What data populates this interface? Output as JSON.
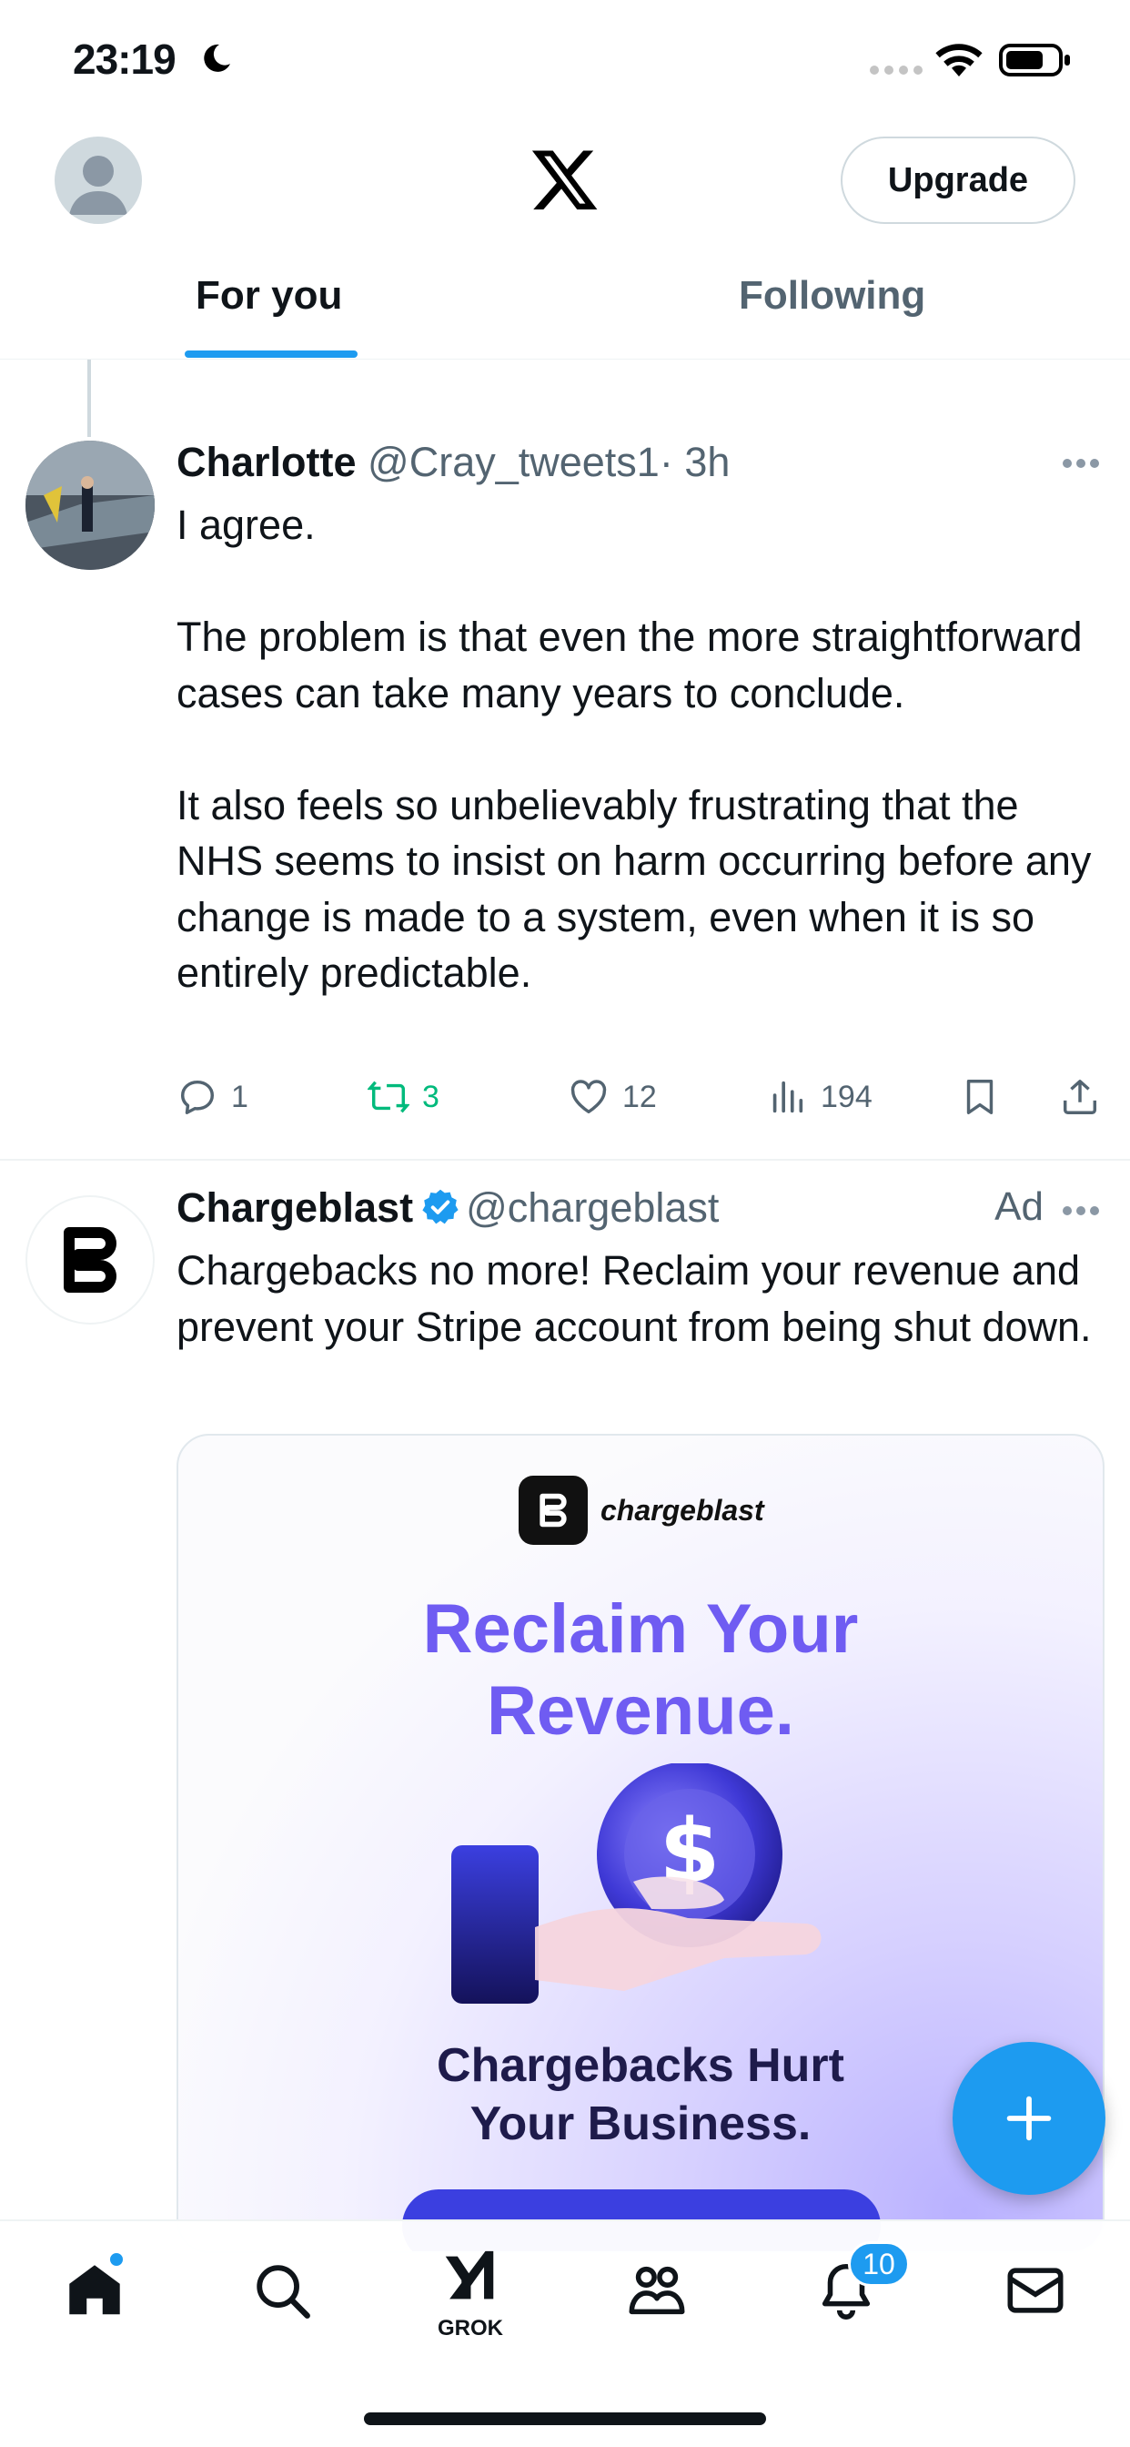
{
  "status_bar": {
    "time": "23:19"
  },
  "header": {
    "upgrade_label": "Upgrade",
    "tabs": [
      {
        "label": "For you",
        "active": true
      },
      {
        "label": "Following",
        "active": false
      }
    ]
  },
  "tweets": [
    {
      "name": "Charlotte",
      "handle": "@Cray_tweets1",
      "time": "· 3h",
      "body": [
        "I agree.",
        "The problem is that even the more straightforward cases can take many years to conclude.",
        "It also feels so unbelievably frustrating that the NHS seems to insist on harm occurring before any change is made to a system, even when it is so entirely predictable."
      ],
      "stats": {
        "replies": "1",
        "reposts": "3",
        "likes": "12",
        "views": "194"
      }
    }
  ],
  "ad": {
    "name": "Chargeblast",
    "handle": "@chargeblast",
    "label": "Ad",
    "body": "Chargebacks no more! Reclaim your revenue and prevent your Stripe account from being shut down.",
    "card": {
      "brand": "chargeblast",
      "headline_line1": "Reclaim Your",
      "headline_line2": "Revenue.",
      "sub_line1": "Chargebacks Hurt",
      "sub_line2": "Your Business."
    }
  },
  "tabbar": {
    "grok_label": "GROK",
    "notifications_count": "10"
  },
  "colors": {
    "accent": "#1d9bf0",
    "repost_green": "#00ba7c",
    "muted": "#536471"
  },
  "icons": [
    "moon-icon",
    "wifi-icon",
    "battery-icon",
    "x-logo-icon",
    "more-icon",
    "reply-icon",
    "repost-icon",
    "like-icon",
    "views-icon",
    "bookmark-icon",
    "share-icon",
    "verified-icon",
    "plus-icon",
    "home-icon",
    "search-icon",
    "grok-icon",
    "communities-icon",
    "bell-icon",
    "mail-icon"
  ]
}
